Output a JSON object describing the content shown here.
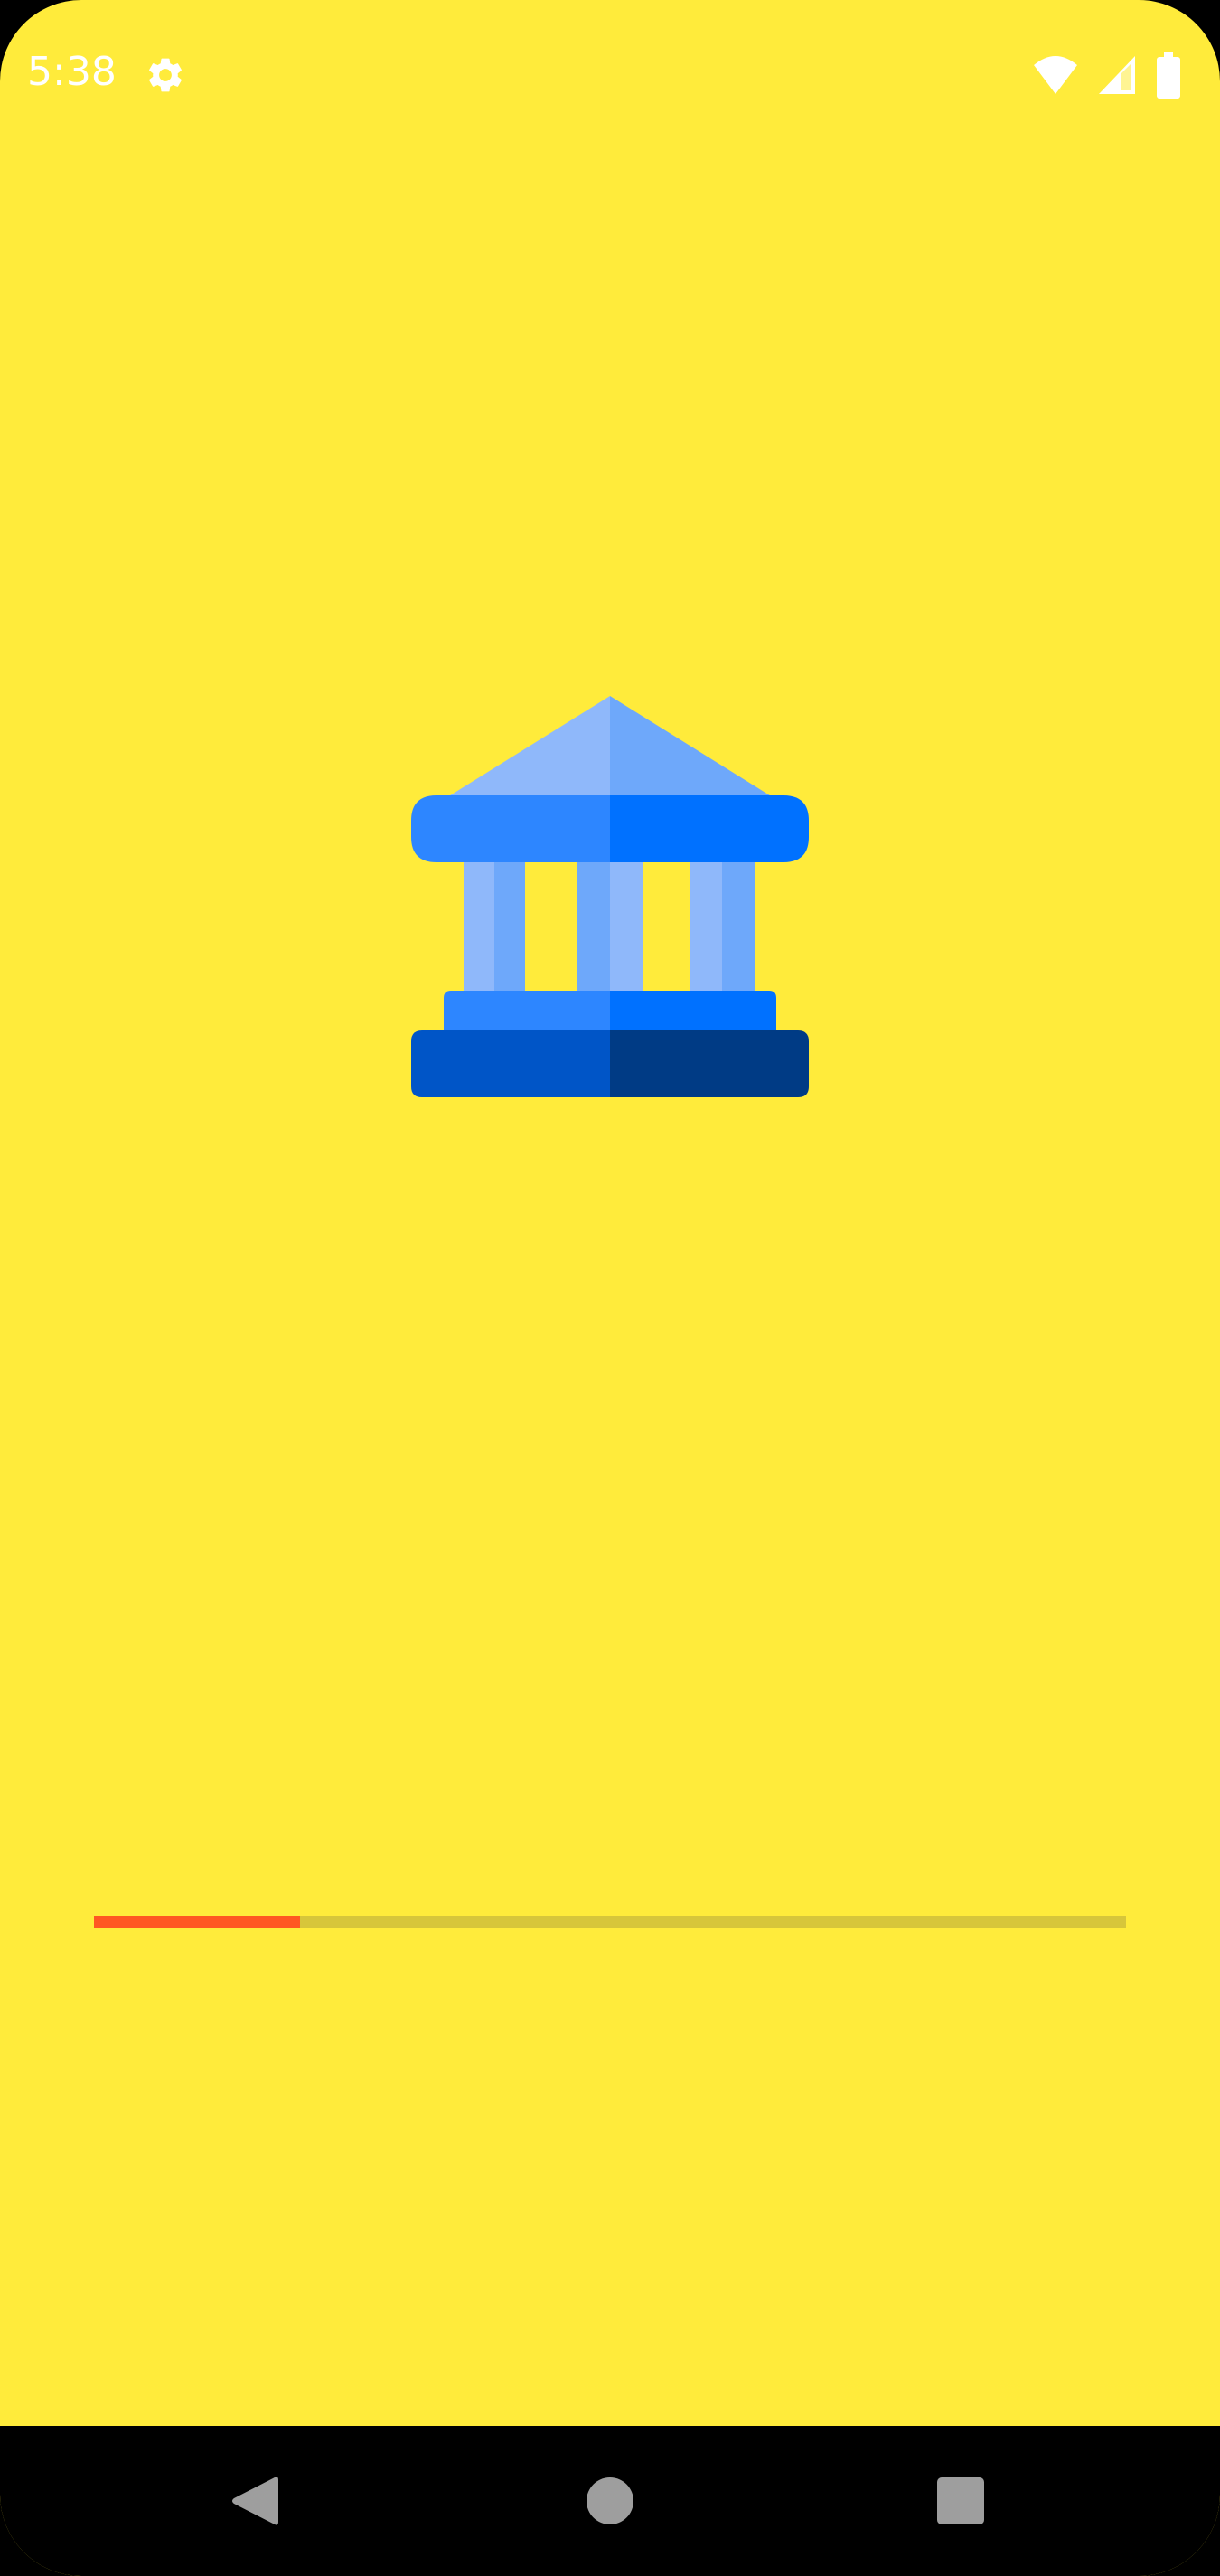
{
  "status_bar": {
    "time": "5:38",
    "icons": [
      "gear-icon",
      "wifi-icon",
      "signal-icon",
      "battery-icon"
    ]
  },
  "splash": {
    "logo_icon": "bank-building-icon",
    "background_color": "#FFEB3B"
  },
  "progress": {
    "value_percent": 20,
    "track_color": "#D7C63A",
    "fill_color": "#FF5722"
  },
  "nav_bar": {
    "buttons": [
      "back-icon",
      "home-icon",
      "recents-icon"
    ]
  }
}
